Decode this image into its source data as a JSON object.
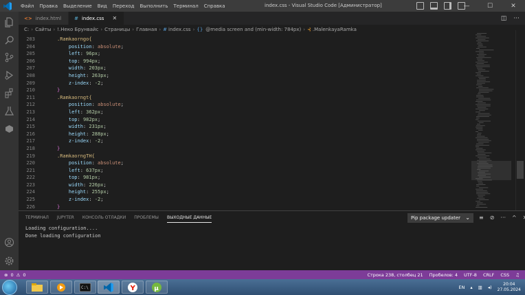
{
  "window": {
    "title": "index.css - Visual Studio Code [Администратор]",
    "menu": [
      "Файл",
      "Правка",
      "Выделение",
      "Вид",
      "Переход",
      "Выполнить",
      "Терминал",
      "Справка"
    ]
  },
  "tabs": [
    {
      "label": "index.html",
      "icon": "<>",
      "icon_color": "#e37933",
      "active": false
    },
    {
      "label": "index.css",
      "icon": "#",
      "icon_color": "#519aba",
      "active": true
    }
  ],
  "breadcrumb": {
    "items": [
      "C:",
      "Сайты",
      "!.Неко Брунвайс",
      "Страницы",
      "Главная",
      "index.css",
      "@media screen and (min-width: 784px)",
      ".MalenkayaRamka"
    ],
    "braces": "{}"
  },
  "code": {
    "lines": [
      {
        "n": "203",
        "sel": ".Ramkaorngo{"
      },
      {
        "n": "204",
        "prop": "position",
        "val": "absolute"
      },
      {
        "n": "205",
        "prop": "left",
        "val": "96px"
      },
      {
        "n": "206",
        "prop": "top",
        "val": "994px"
      },
      {
        "n": "207",
        "prop": "width",
        "val": "203px"
      },
      {
        "n": "208",
        "prop": "height",
        "val": "263px"
      },
      {
        "n": "209",
        "prop": "z-index",
        "val": "-2"
      },
      {
        "n": "210",
        "close": "}"
      },
      {
        "n": "211",
        "sel": ".Ramkaorngt{"
      },
      {
        "n": "212",
        "prop": "position",
        "val": "absolute"
      },
      {
        "n": "213",
        "prop": "left",
        "val": "362px"
      },
      {
        "n": "214",
        "prop": "top",
        "val": "982px"
      },
      {
        "n": "215",
        "prop": "width",
        "val": "231px"
      },
      {
        "n": "216",
        "prop": "height",
        "val": "288px"
      },
      {
        "n": "217",
        "prop": "z-index",
        "val": "-2"
      },
      {
        "n": "218",
        "close": "}"
      },
      {
        "n": "219",
        "sel": ".RamkaorngTH{"
      },
      {
        "n": "220",
        "prop": "position",
        "val": "absolute"
      },
      {
        "n": "221",
        "prop": "left",
        "val": "637px"
      },
      {
        "n": "222",
        "prop": "top",
        "val": "981px"
      },
      {
        "n": "223",
        "prop": "width",
        "val": "226px"
      },
      {
        "n": "224",
        "prop": "height",
        "val": "255px"
      },
      {
        "n": "225",
        "prop": "z-index",
        "val": "-2"
      },
      {
        "n": "226",
        "close": "}"
      }
    ]
  },
  "panel": {
    "tabs": [
      "ТЕРМИНАЛ",
      "JUPYTER",
      "КОНСОЛЬ ОТЛАДКИ",
      "ПРОБЛЕМЫ",
      "ВЫХОДНЫЕ ДАННЫЕ"
    ],
    "active_tab": "ВЫХОДНЫЕ ДАННЫЕ",
    "output_channel": "Pip package updater",
    "output": [
      "Loading configuration....",
      "Done loading configuration"
    ]
  },
  "statusbar": {
    "errors": "0",
    "warnings": "0",
    "position": "Строка 238, столбец 21",
    "spaces": "Пробелов: 4",
    "encoding": "UTF-8",
    "eol": "CRLF",
    "language": "CSS",
    "background": "#7d3c98"
  },
  "taskbar": {
    "lang": "EN",
    "time": "20:04",
    "date": "27.05.2024"
  }
}
